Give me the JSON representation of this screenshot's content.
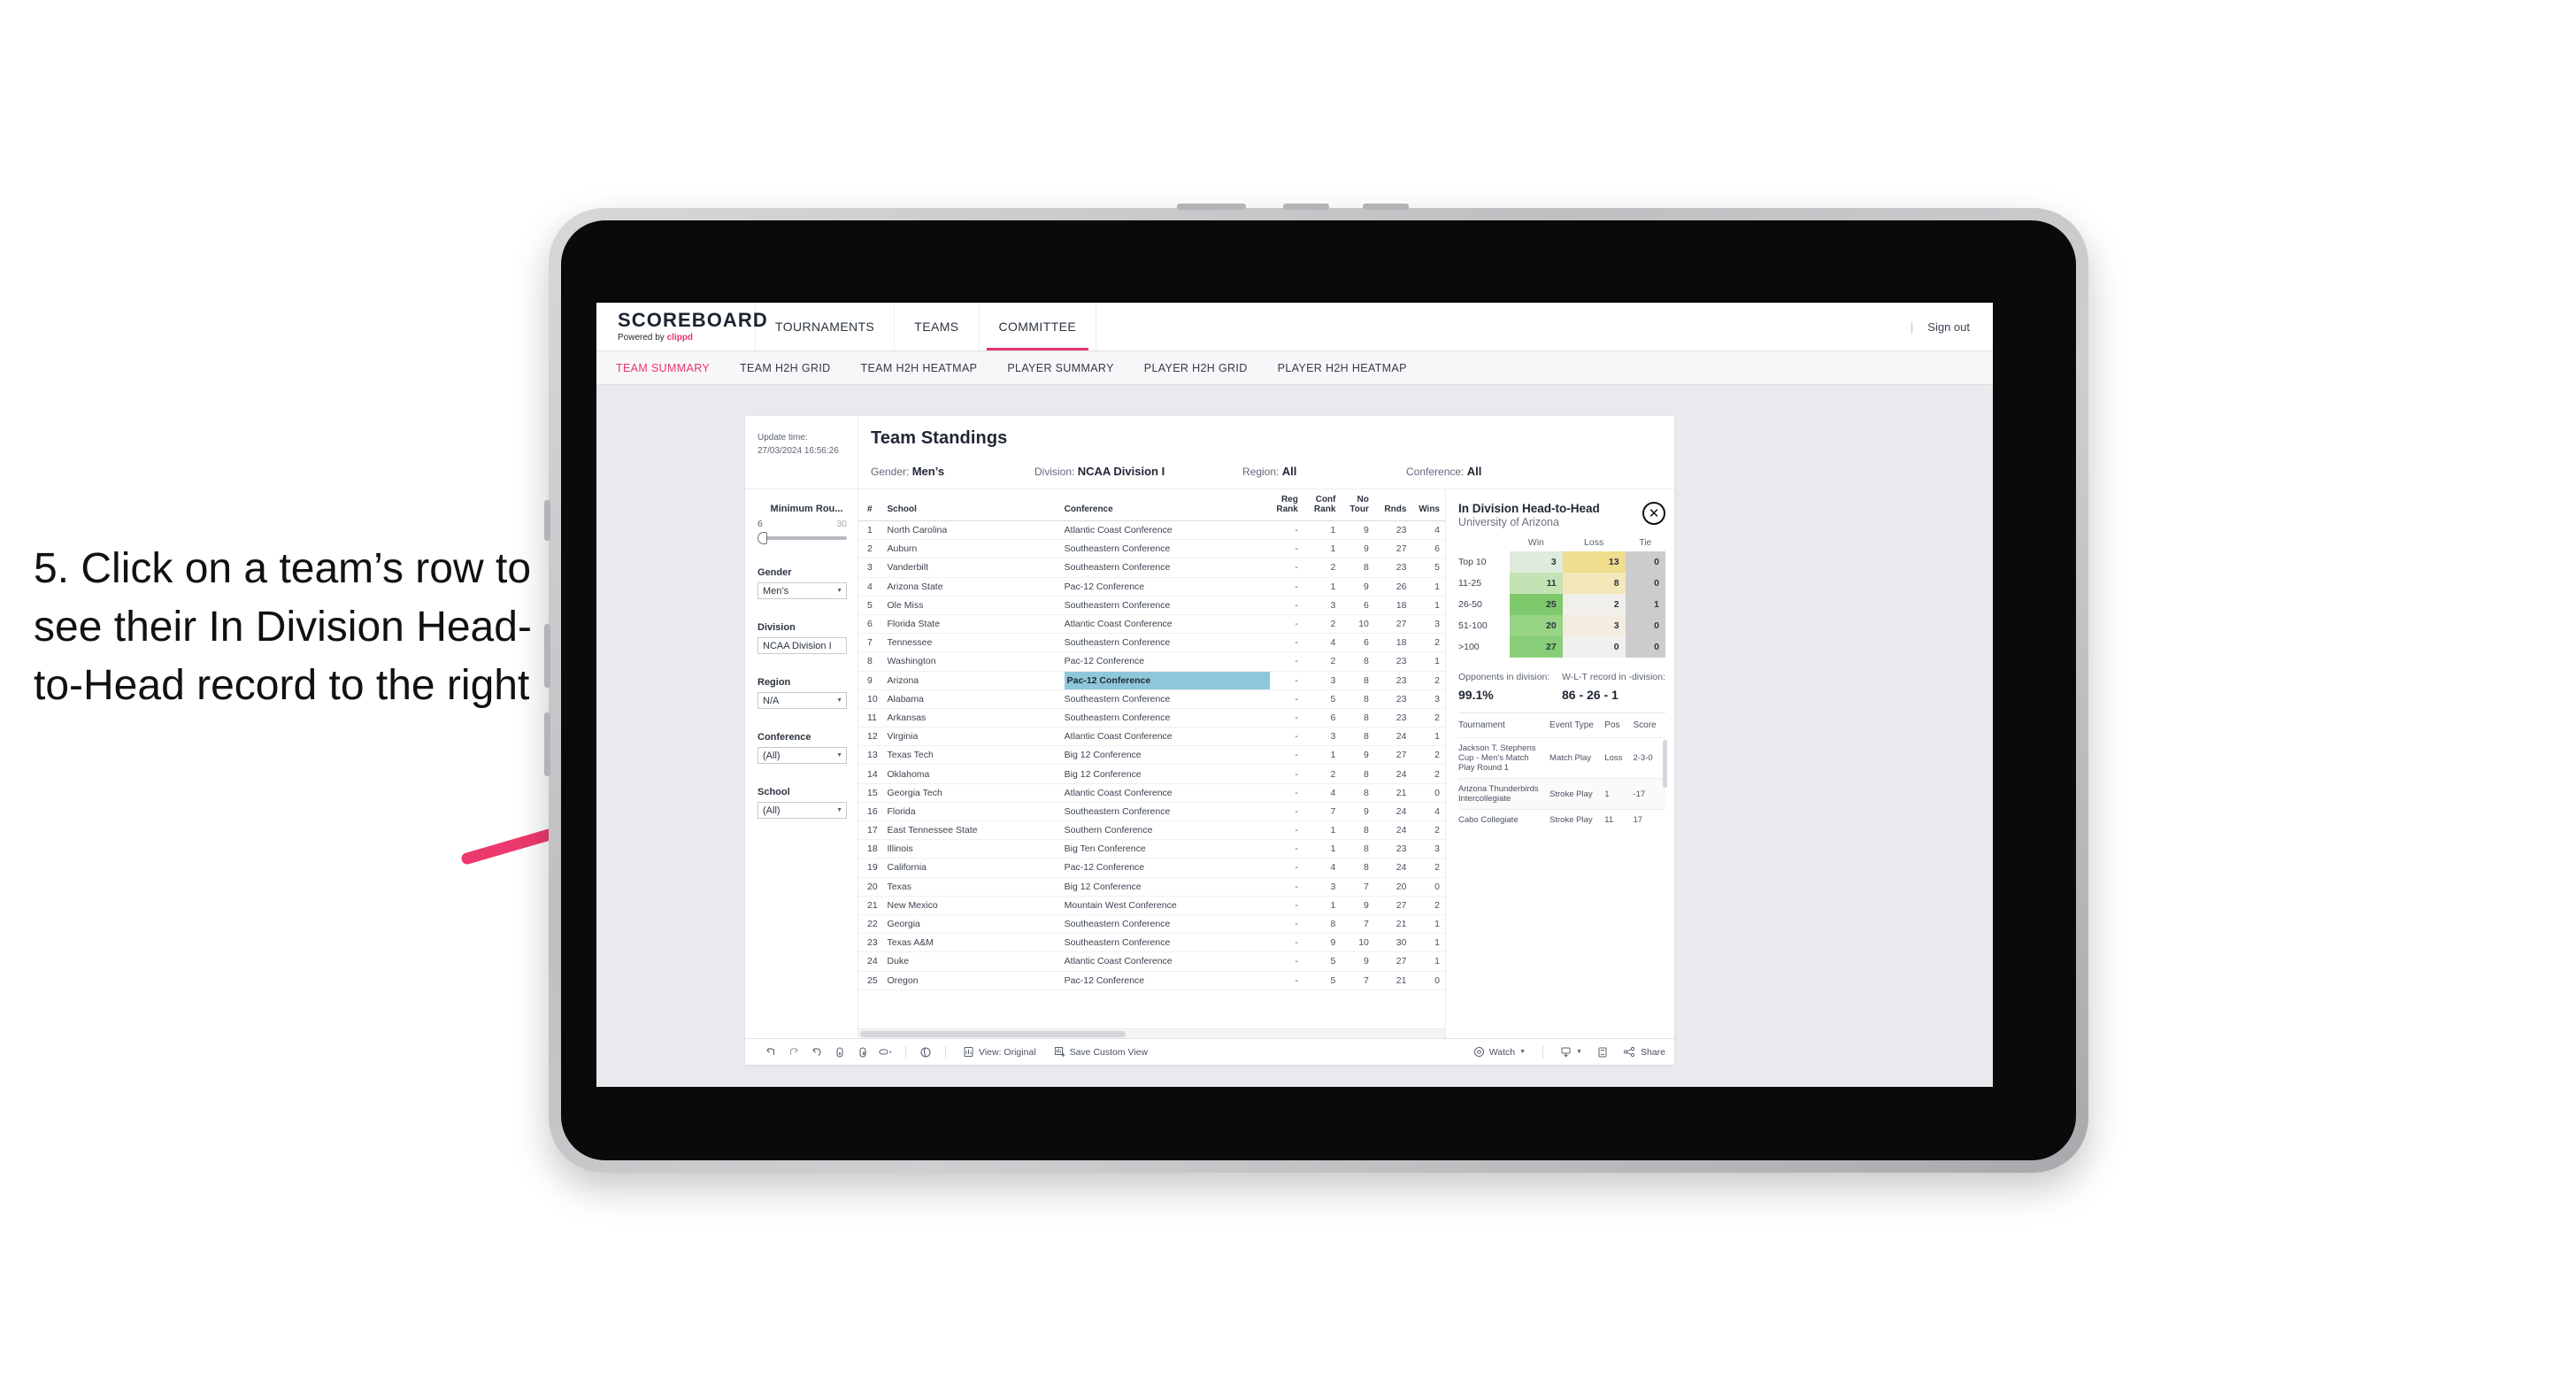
{
  "annotation": {
    "text": "5. Click on a team’s row to see their In Division Head-to-Head record to the right",
    "arrow_color": "#ed3a6e"
  },
  "topnav": {
    "brand_title": "SCOREBOARD",
    "brand_sub_prefix": "Powered by ",
    "brand_sub_name": "clippd",
    "items": [
      {
        "label": "TOURNAMENTS",
        "active": false
      },
      {
        "label": "TEAMS",
        "active": false
      },
      {
        "label": "COMMITTEE",
        "active": true
      }
    ],
    "separator": "|",
    "signout": "Sign out",
    "accent": "#e8336d"
  },
  "subnav": {
    "items": [
      {
        "label": "TEAM SUMMARY",
        "active": true
      },
      {
        "label": "TEAM H2H GRID",
        "active": false
      },
      {
        "label": "TEAM H2H HEATMAP",
        "active": false
      },
      {
        "label": "PLAYER SUMMARY",
        "active": false
      },
      {
        "label": "PLAYER H2H GRID",
        "active": false
      },
      {
        "label": "PLAYER H2H HEATMAP",
        "active": false
      }
    ]
  },
  "viz": {
    "update_label": "Update time:",
    "update_time": "27/03/2024 16:56:26",
    "title": "Team Standings",
    "header_filters": [
      {
        "label": "Gender:",
        "value": "Men’s"
      },
      {
        "label": "Division:",
        "value": "NCAA Division I"
      },
      {
        "label": "Region:",
        "value": "All"
      },
      {
        "label": "Conference:",
        "value": "All"
      }
    ]
  },
  "sidebar": {
    "slider": {
      "label": "Minimum Rou...",
      "min": "6",
      "max": "30"
    },
    "filters": [
      {
        "label": "Gender",
        "value": "Men’s"
      },
      {
        "label": "Division",
        "value": "NCAA Division I"
      },
      {
        "label": "Region",
        "value": "N/A"
      },
      {
        "label": "Conference",
        "value": "(All)"
      },
      {
        "label": "School",
        "value": "(All)"
      }
    ]
  },
  "standings": {
    "columns": [
      "#",
      "School",
      "Conference",
      "Reg Rank",
      "Conf Rank",
      "No Tour",
      "Rnds",
      "Wins"
    ],
    "columns_wrapped": [
      {
        "l1": "#",
        "l2": ""
      },
      {
        "l1": "School",
        "l2": ""
      },
      {
        "l1": "Conference",
        "l2": ""
      },
      {
        "l1": "Reg",
        "l2": "Rank"
      },
      {
        "l1": "Conf",
        "l2": "Rank"
      },
      {
        "l1": "No",
        "l2": "Tour"
      },
      {
        "l1": "Rnds",
        "l2": ""
      },
      {
        "l1": "Wins",
        "l2": ""
      }
    ],
    "selected_row_index": 8,
    "rows": [
      {
        "rank": "1",
        "school": "North Carolina",
        "conference": "Atlantic Coast Conference",
        "reg_rank": "-",
        "conf_rank": "1",
        "no_tour": "9",
        "rnds": "23",
        "wins": "4"
      },
      {
        "rank": "2",
        "school": "Auburn",
        "conference": "Southeastern Conference",
        "reg_rank": "-",
        "conf_rank": "1",
        "no_tour": "9",
        "rnds": "27",
        "wins": "6"
      },
      {
        "rank": "3",
        "school": "Vanderbilt",
        "conference": "Southeastern Conference",
        "reg_rank": "-",
        "conf_rank": "2",
        "no_tour": "8",
        "rnds": "23",
        "wins": "5"
      },
      {
        "rank": "4",
        "school": "Arizona State",
        "conference": "Pac-12 Conference",
        "reg_rank": "-",
        "conf_rank": "1",
        "no_tour": "9",
        "rnds": "26",
        "wins": "1"
      },
      {
        "rank": "5",
        "school": "Ole Miss",
        "conference": "Southeastern Conference",
        "reg_rank": "-",
        "conf_rank": "3",
        "no_tour": "6",
        "rnds": "18",
        "wins": "1"
      },
      {
        "rank": "6",
        "school": "Florida State",
        "conference": "Atlantic Coast Conference",
        "reg_rank": "-",
        "conf_rank": "2",
        "no_tour": "10",
        "rnds": "27",
        "wins": "3"
      },
      {
        "rank": "7",
        "school": "Tennessee",
        "conference": "Southeastern Conference",
        "reg_rank": "-",
        "conf_rank": "4",
        "no_tour": "6",
        "rnds": "18",
        "wins": "2"
      },
      {
        "rank": "8",
        "school": "Washington",
        "conference": "Pac-12 Conference",
        "reg_rank": "-",
        "conf_rank": "2",
        "no_tour": "8",
        "rnds": "23",
        "wins": "1"
      },
      {
        "rank": "9",
        "school": "Arizona",
        "conference": "Pac-12 Conference",
        "reg_rank": "-",
        "conf_rank": "3",
        "no_tour": "8",
        "rnds": "23",
        "wins": "2"
      },
      {
        "rank": "10",
        "school": "Alabama",
        "conference": "Southeastern Conference",
        "reg_rank": "-",
        "conf_rank": "5",
        "no_tour": "8",
        "rnds": "23",
        "wins": "3"
      },
      {
        "rank": "11",
        "school": "Arkansas",
        "conference": "Southeastern Conference",
        "reg_rank": "-",
        "conf_rank": "6",
        "no_tour": "8",
        "rnds": "23",
        "wins": "2"
      },
      {
        "rank": "12",
        "school": "Virginia",
        "conference": "Atlantic Coast Conference",
        "reg_rank": "-",
        "conf_rank": "3",
        "no_tour": "8",
        "rnds": "24",
        "wins": "1"
      },
      {
        "rank": "13",
        "school": "Texas Tech",
        "conference": "Big 12 Conference",
        "reg_rank": "-",
        "conf_rank": "1",
        "no_tour": "9",
        "rnds": "27",
        "wins": "2"
      },
      {
        "rank": "14",
        "school": "Oklahoma",
        "conference": "Big 12 Conference",
        "reg_rank": "-",
        "conf_rank": "2",
        "no_tour": "8",
        "rnds": "24",
        "wins": "2"
      },
      {
        "rank": "15",
        "school": "Georgia Tech",
        "conference": "Atlantic Coast Conference",
        "reg_rank": "-",
        "conf_rank": "4",
        "no_tour": "8",
        "rnds": "21",
        "wins": "0"
      },
      {
        "rank": "16",
        "school": "Florida",
        "conference": "Southeastern Conference",
        "reg_rank": "-",
        "conf_rank": "7",
        "no_tour": "9",
        "rnds": "24",
        "wins": "4"
      },
      {
        "rank": "17",
        "school": "East Tennessee State",
        "conference": "Southern Conference",
        "reg_rank": "-",
        "conf_rank": "1",
        "no_tour": "8",
        "rnds": "24",
        "wins": "2"
      },
      {
        "rank": "18",
        "school": "Illinois",
        "conference": "Big Ten Conference",
        "reg_rank": "-",
        "conf_rank": "1",
        "no_tour": "8",
        "rnds": "23",
        "wins": "3"
      },
      {
        "rank": "19",
        "school": "California",
        "conference": "Pac-12 Conference",
        "reg_rank": "-",
        "conf_rank": "4",
        "no_tour": "8",
        "rnds": "24",
        "wins": "2"
      },
      {
        "rank": "20",
        "school": "Texas",
        "conference": "Big 12 Conference",
        "reg_rank": "-",
        "conf_rank": "3",
        "no_tour": "7",
        "rnds": "20",
        "wins": "0"
      },
      {
        "rank": "21",
        "school": "New Mexico",
        "conference": "Mountain West Conference",
        "reg_rank": "-",
        "conf_rank": "1",
        "no_tour": "9",
        "rnds": "27",
        "wins": "2"
      },
      {
        "rank": "22",
        "school": "Georgia",
        "conference": "Southeastern Conference",
        "reg_rank": "-",
        "conf_rank": "8",
        "no_tour": "7",
        "rnds": "21",
        "wins": "1"
      },
      {
        "rank": "23",
        "school": "Texas A&M",
        "conference": "Southeastern Conference",
        "reg_rank": "-",
        "conf_rank": "9",
        "no_tour": "10",
        "rnds": "30",
        "wins": "1"
      },
      {
        "rank": "24",
        "school": "Duke",
        "conference": "Atlantic Coast Conference",
        "reg_rank": "-",
        "conf_rank": "5",
        "no_tour": "9",
        "rnds": "27",
        "wins": "1"
      },
      {
        "rank": "25",
        "school": "Oregon",
        "conference": "Pac-12 Conference",
        "reg_rank": "-",
        "conf_rank": "5",
        "no_tour": "7",
        "rnds": "21",
        "wins": "0"
      }
    ]
  },
  "detail": {
    "title": "In Division Head-to-Head",
    "subtitle": "University of Arizona",
    "close_icon": "✕",
    "stats": [
      {
        "label": "Opponents in division:",
        "value": "99.1%"
      },
      {
        "label": "W-L-T record in -division:",
        "value": "86 - 26 - 1"
      }
    ],
    "tournaments": {
      "columns": [
        "Tournament",
        "Event Type",
        "Pos",
        "Score"
      ],
      "rows": [
        {
          "name": "Jackson T. Stephens Cup - Men’s Match Play Round 1",
          "type": "Match Play",
          "pos": "Loss",
          "score": "2-3-0"
        },
        {
          "name": "Arizona Thunderbirds Intercollegiate",
          "type": "Stroke Play",
          "pos": "1",
          "score": "-17"
        },
        {
          "name": "Cabo Collegiate",
          "type": "Stroke Play",
          "pos": "11",
          "score": "17"
        }
      ]
    }
  },
  "chart_data": {
    "type": "heatmap",
    "title": "In Division Head-to-Head",
    "subtitle": "University of Arizona",
    "columns": [
      "Win",
      "Loss",
      "Tie"
    ],
    "rows": [
      "Top 10",
      "11-25",
      "26-50",
      "51-100",
      ">100"
    ],
    "values": [
      [
        3,
        13,
        0
      ],
      [
        11,
        8,
        0
      ],
      [
        25,
        2,
        1
      ],
      [
        20,
        3,
        0
      ],
      [
        27,
        0,
        0
      ]
    ],
    "cell_colors": [
      [
        "#dfebdd",
        "#f0dd8e",
        "#cccccc"
      ],
      [
        "#c4e3b4",
        "#f4e7b9",
        "#cccccc"
      ],
      [
        "#7fc96d",
        "#f0efe9",
        "#cccccc"
      ],
      [
        "#98d486",
        "#f3ece0",
        "#cccccc"
      ],
      [
        "#88ce78",
        "#f0f0ef",
        "#cccccc"
      ]
    ],
    "xlabel": "",
    "ylabel": "",
    "legend": "none",
    "grid": false
  },
  "toolbar": {
    "icons": [
      "undo-icon",
      "redo-icon",
      "revert-icon",
      "refresh-data-icon",
      "pause-icon",
      "highlight-icon",
      "clear-sheet-icon"
    ],
    "view_label": "View: Original",
    "save_view_label": "Save Custom View",
    "watch_label": "Watch",
    "share_label": "Share"
  }
}
